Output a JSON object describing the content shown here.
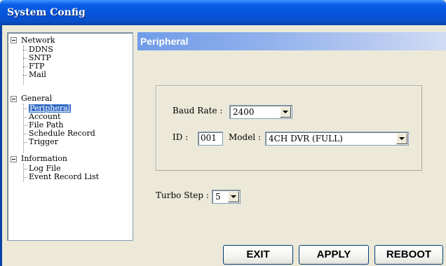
{
  "window": {
    "title": "System Config"
  },
  "tree": {
    "network": {
      "label": "Network",
      "children": [
        "DDNS",
        "SNTP",
        "FTP",
        "Mail"
      ]
    },
    "general": {
      "label": "General",
      "children": [
        "Peripheral",
        "Account",
        "File Path",
        "Schedule Record",
        "Trigger"
      ],
      "selected": "Peripheral"
    },
    "information": {
      "label": "Information",
      "children": [
        "Log File",
        "Event Record List"
      ]
    }
  },
  "panel": {
    "title": "Peripheral",
    "baud_rate_label": "Baud Rate :",
    "baud_rate_value": "2400",
    "id_label": "ID :",
    "id_value": "001",
    "model_label": "Model :",
    "model_value": "4CH DVR (FULL)",
    "turbo_step_label": "Turbo Step :",
    "turbo_step_value": "5"
  },
  "buttons": {
    "exit": "EXIT",
    "apply": "APPLY",
    "reboot": "REBOOT"
  },
  "colors": {
    "titlebar": "#0553d9",
    "panel_header": "#8fb0ec",
    "selection": "#316ac5",
    "background": "#ece9d8"
  }
}
